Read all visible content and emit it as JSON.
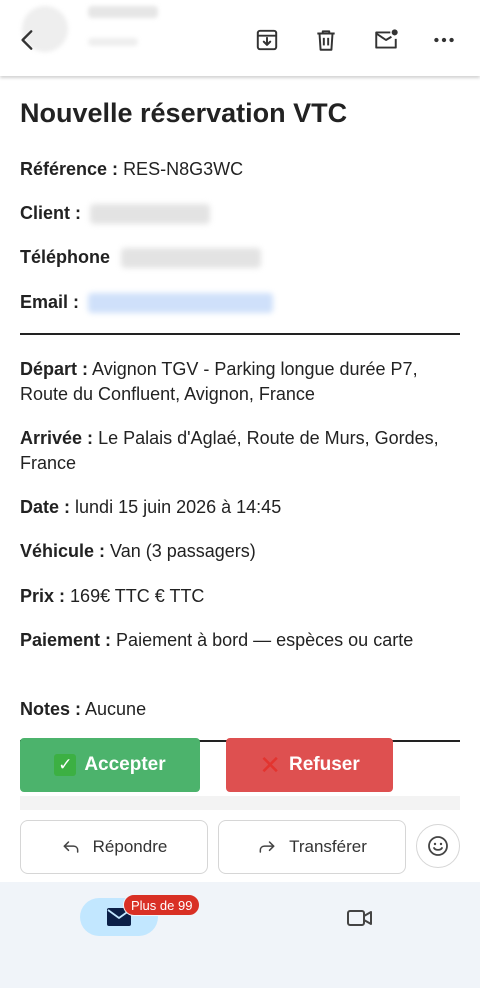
{
  "toolbar": {
    "back_icon": "arrow-back-icon",
    "archive_icon": "archive-icon",
    "delete_icon": "trash-icon",
    "unread_icon": "mark-unread-icon",
    "more_icon": "more-horizontal-icon"
  },
  "email": {
    "title": "Nouvelle réservation VTC",
    "reference": {
      "label": "Référence :",
      "value": "RES-N8G3WC"
    },
    "client": {
      "label": "Client :"
    },
    "telephone": {
      "label": "Téléphone"
    },
    "email_field": {
      "label": "Email :"
    },
    "depart": {
      "label": "Départ :",
      "value": "Avignon TGV - Parking longue durée P7, Route du Confluent, Avignon, France"
    },
    "arrivee": {
      "label": "Arrivée :",
      "value": "Le Palais d'Aglaé, Route de Murs, Gordes, France"
    },
    "date": {
      "label": "Date :",
      "value": "lundi 15 juin 2026 à 14:45"
    },
    "vehicule": {
      "label": "Véhicule :",
      "value": "Van (3 passagers)"
    },
    "prix": {
      "label": "Prix :",
      "value": "169€ TTC € TTC"
    },
    "paiement": {
      "label": "Paiement :",
      "value": "Paiement à bord — espèces ou carte"
    },
    "notes": {
      "label": "Notes :",
      "value": "Aucune"
    },
    "accept_label": "Accepter",
    "refuse_label": "Refuser"
  },
  "actions": {
    "reply_label": "Répondre",
    "forward_label": "Transférer"
  },
  "bottom_nav": {
    "badge": "Plus de 99"
  },
  "colors": {
    "accept": "#4cb36c",
    "refuse": "#de5050",
    "mail_pill": "#c2e7ff",
    "badge": "#d93025"
  }
}
